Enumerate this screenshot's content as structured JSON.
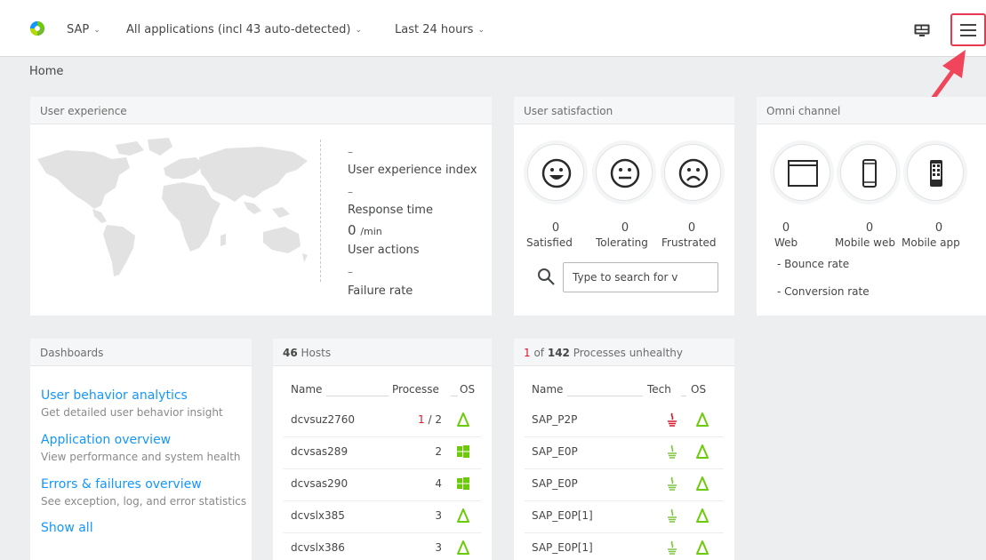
{
  "topbar": {
    "app_selector": "SAP",
    "applications_filter": "All applications (incl 43 auto-detected)",
    "timeframe": "Last 24 hours"
  },
  "breadcrumb": "Home",
  "user_experience": {
    "title": "User experience",
    "ux_index_value": "–",
    "ux_index_label": "User experience index",
    "response_time_value": "–",
    "response_time_label": "Response time",
    "user_actions_value": "0",
    "user_actions_unit": "/min",
    "user_actions_label": "User actions",
    "failure_rate_value": "–",
    "failure_rate_label": "Failure rate"
  },
  "user_satisfaction": {
    "title": "User satisfaction",
    "satisfied_count": "0",
    "satisfied_label": "Satisfied",
    "tolerating_count": "0",
    "tolerating_label": "Tolerating",
    "frustrated_count": "0",
    "frustrated_label": "Frustrated",
    "search_placeholder": "Type to search for v"
  },
  "omni_channel": {
    "title": "Omni channel",
    "web_count": "0",
    "web_label": "Web",
    "mobile_web_count": "0",
    "mobile_web_label": "Mobile web",
    "mobile_app_count": "0",
    "mobile_app_label": "Mobile app",
    "bounce_rate_label": "- Bounce rate",
    "conversion_rate_label": "- Conversion rate"
  },
  "dashboards": {
    "title": "Dashboards",
    "items": [
      {
        "label": "User behavior analytics",
        "description": "Get detailed user behavior insight"
      },
      {
        "label": "Application overview",
        "description": "View performance and system health"
      },
      {
        "label": "Errors & failures overview",
        "description": "See exception, log, and error statistics"
      }
    ],
    "show_all": "Show all"
  },
  "hosts": {
    "count": "46",
    "title": "Hosts",
    "col_name": "Name",
    "col_processes": "Processe",
    "col_os": "OS",
    "rows": [
      {
        "name": "dcvsuz2760",
        "processes": "1 / 2",
        "os": "linux"
      },
      {
        "name": "dcvsas289",
        "processes": "2",
        "os": "windows"
      },
      {
        "name": "dcvsas290",
        "processes": "4",
        "os": "windows"
      },
      {
        "name": "dcvslx385",
        "processes": "3",
        "os": "linux"
      },
      {
        "name": "dcvslx386",
        "processes": "3",
        "os": "linux"
      }
    ]
  },
  "processes": {
    "unhealthy_count": "1",
    "title_mid": " of ",
    "total": "142",
    "title_tail": " Processes unhealthy",
    "col_name": "Name",
    "col_tech": "Tech",
    "col_os": "OS",
    "rows": [
      {
        "name": "SAP_P2P",
        "tech": "java-unhealthy",
        "os": "linux"
      },
      {
        "name": "SAP_E0P",
        "tech": "java",
        "os": "linux"
      },
      {
        "name": "SAP_E0P",
        "tech": "java",
        "os": "linux"
      },
      {
        "name": "SAP_E0P[1]",
        "tech": "java",
        "os": "linux"
      },
      {
        "name": "SAP_E0P[1]",
        "tech": "java",
        "os": "linux"
      }
    ]
  },
  "colors": {
    "link": "#1496ff",
    "unhealthy": "#dc172a",
    "highlight": "#e8394e",
    "linux_icon": "#6bcb0b",
    "windows_icon": "#6bcb0b",
    "java_ok": "#7dc540",
    "java_bad": "#dc172a"
  }
}
